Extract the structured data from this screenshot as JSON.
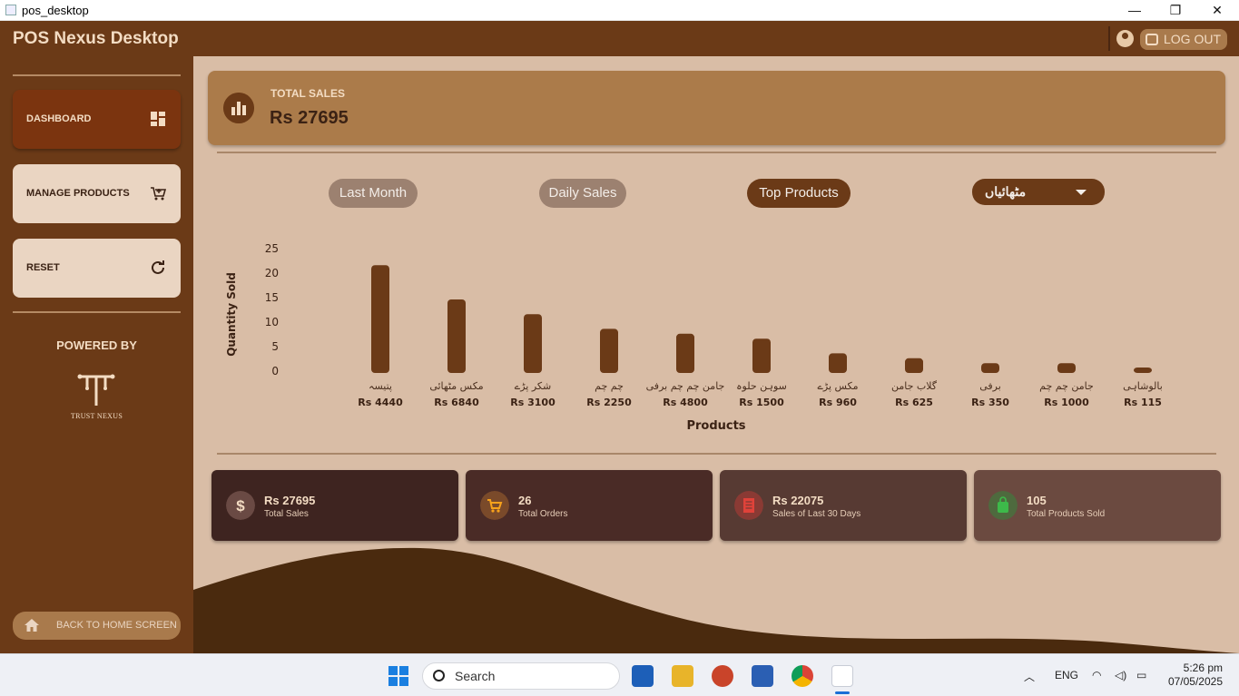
{
  "window": {
    "title": "pos_desktop",
    "min": "—",
    "max": "❐",
    "close": "✕"
  },
  "header": {
    "brand": "POS Nexus Desktop",
    "logout_label": "LOG OUT"
  },
  "sidebar": {
    "items": [
      {
        "label": "DASHBOARD",
        "icon": "dashboard-icon",
        "active": true
      },
      {
        "label": "MANAGE PRODUCTS",
        "icon": "cart-icon",
        "active": false
      },
      {
        "label": "RESET",
        "icon": "refresh-icon",
        "active": false
      }
    ],
    "powered_by": "POWERED BY",
    "logo_text": "TRUST NEXUS",
    "back_label": "BACK TO HOME SCREEN"
  },
  "summary": {
    "label": "TOTAL SALES",
    "value": "Rs 27695"
  },
  "filters": {
    "last_month": "Last Month",
    "daily_sales": "Daily Sales",
    "top_products": "Top Products",
    "category": "مٹھائیاں"
  },
  "chart_data": {
    "type": "bar",
    "xlabel": "Products",
    "ylabel": "Quantity Sold",
    "ylim": [
      0,
      25
    ],
    "yticks": [
      0,
      5,
      10,
      15,
      20,
      25
    ],
    "grid": false,
    "color": "#6b3a17",
    "categories": [
      "پتیسہ",
      "مکس مٹھائی",
      "شکر پڑے",
      "چم چم",
      "جامن چم چم برفی",
      "سوہن حلوہ",
      "مکس پڑے",
      "گلاب جامن",
      "برفی",
      "جامن چم چم",
      "بالوشاہی"
    ],
    "values": [
      22,
      15,
      12,
      9,
      8,
      7,
      4,
      3,
      2,
      2,
      1
    ],
    "sales_labels": [
      "Rs 4440",
      "Rs 6840",
      "Rs 3100",
      "Rs 2250",
      "Rs 4800",
      "Rs 1500",
      "Rs 960",
      "Rs 625",
      "Rs 350",
      "Rs 1000",
      "Rs 115"
    ]
  },
  "stats": [
    {
      "value": "Rs 27695",
      "label": "Total Sales",
      "icon": "dollar-icon",
      "bg": "#3e2420",
      "icon_bg": "#6a4a44"
    },
    {
      "value": "26",
      "label": "Total Orders",
      "icon": "cart-icon",
      "bg": "#4a2b26",
      "icon_bg": "#7a4a2a"
    },
    {
      "value": "Rs 22075",
      "label": "Sales of Last 30 Days",
      "icon": "receipt-icon",
      "bg": "#573a33",
      "icon_bg": "#8a3a34"
    },
    {
      "value": "105",
      "label": "Total Products Sold",
      "icon": "bag-icon",
      "bg": "#6b4a40",
      "icon_bg": "#4e6a3e"
    }
  ],
  "taskbar": {
    "search_placeholder": "Search",
    "lang": "ENG",
    "time": "5:26 pm",
    "date": "07/05/2025"
  }
}
